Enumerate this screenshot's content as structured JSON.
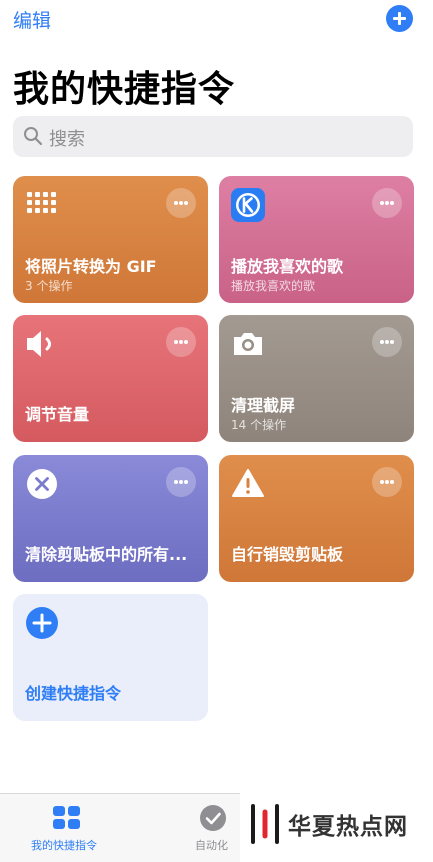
{
  "header": {
    "edit_label": "编辑",
    "title": "我的快捷指令",
    "add_icon": "plus-circle-icon"
  },
  "search": {
    "placeholder": "搜索",
    "icon": "search-icon"
  },
  "shortcuts": [
    {
      "title": "将照片转换为 GIF",
      "subtitle": "3 个操作",
      "icon": "grid-dots-icon",
      "color": "#d9823f"
    },
    {
      "title": "播放我喜欢的歌",
      "subtitle": "播放我喜欢的歌",
      "icon": "kugou-app-icon",
      "color": "#d46f95"
    },
    {
      "title": "调节音量",
      "subtitle": "",
      "icon": "speaker-icon",
      "color": "#de666c"
    },
    {
      "title": "清理截屏",
      "subtitle": "14 个操作",
      "icon": "camera-icon",
      "color": "#988f87"
    },
    {
      "title": "清除剪贴板中的所有...",
      "subtitle": "",
      "icon": "x-circle-icon",
      "color": "#7b7bcd"
    },
    {
      "title": "自行销毁剪贴板",
      "subtitle": "",
      "icon": "warning-icon",
      "color": "#d9823f"
    }
  ],
  "create": {
    "label": "创建快捷指令",
    "icon": "plus-circle-icon",
    "color": "#2f7ef6"
  },
  "tabbar": {
    "tabs": [
      {
        "label": "我的快捷指令",
        "icon": "grid-icon",
        "active": true
      },
      {
        "label": "自动化",
        "icon": "check-circle-icon",
        "active": false
      }
    ]
  },
  "watermark": {
    "text": "华夏热点网"
  },
  "colors": {
    "accent": "#2f7ef6"
  }
}
